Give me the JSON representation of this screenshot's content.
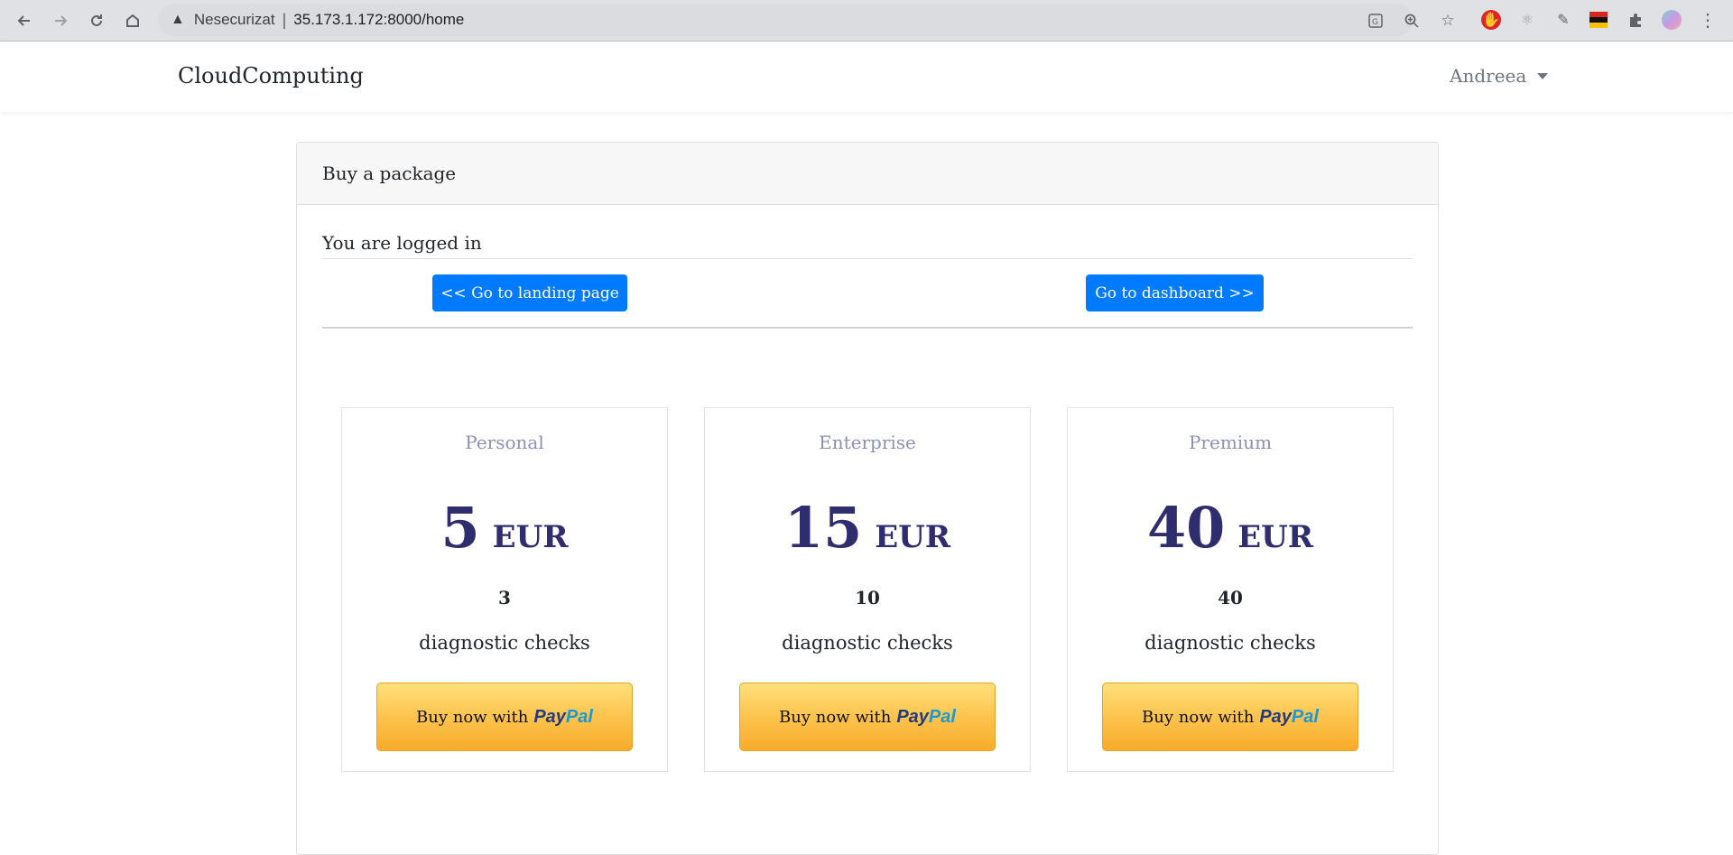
{
  "browser": {
    "security_label": "Nesecurizat",
    "separator": "|",
    "url": "35.173.1.172:8000/home"
  },
  "navbar": {
    "brand": "CloudComputing",
    "user": "Andreea"
  },
  "card": {
    "header": "Buy a package",
    "status_text": "You are logged in",
    "landing_button": "<< Go to landing page",
    "dashboard_button": "Go to dashboard >>"
  },
  "packages": [
    {
      "name": "Personal",
      "price": "5",
      "currency": "EUR",
      "count": "3",
      "description": "diagnostic checks",
      "button_prefix": "Buy now with",
      "button_brand_pay": "Pay",
      "button_brand_pal": "Pal"
    },
    {
      "name": "Enterprise",
      "price": "15",
      "currency": "EUR",
      "count": "10",
      "description": "diagnostic checks",
      "button_prefix": "Buy now with",
      "button_brand_pay": "Pay",
      "button_brand_pal": "Pal"
    },
    {
      "name": "Premium",
      "price": "40",
      "currency": "EUR",
      "count": "40",
      "description": "diagnostic checks",
      "button_prefix": "Buy now with",
      "button_brand_pay": "Pay",
      "button_brand_pal": "Pal"
    }
  ],
  "colors": {
    "primary_button": "#007bff",
    "price_text": "#2f2d6e",
    "package_name": "#8c8fb8",
    "paypal_yellow": "#fcc14a",
    "paypal_dark_blue": "#253b80",
    "paypal_light_blue": "#179bd7"
  },
  "icons": {
    "back": "arrow-left-icon",
    "forward": "arrow-right-icon",
    "reload": "reload-icon",
    "home": "home-icon",
    "warning": "warning-triangle-icon",
    "translate": "translate-icon",
    "zoom": "zoom-icon",
    "bookmark": "star-icon",
    "extensions": "puzzle-icon",
    "menu": "kebab-menu-icon"
  }
}
